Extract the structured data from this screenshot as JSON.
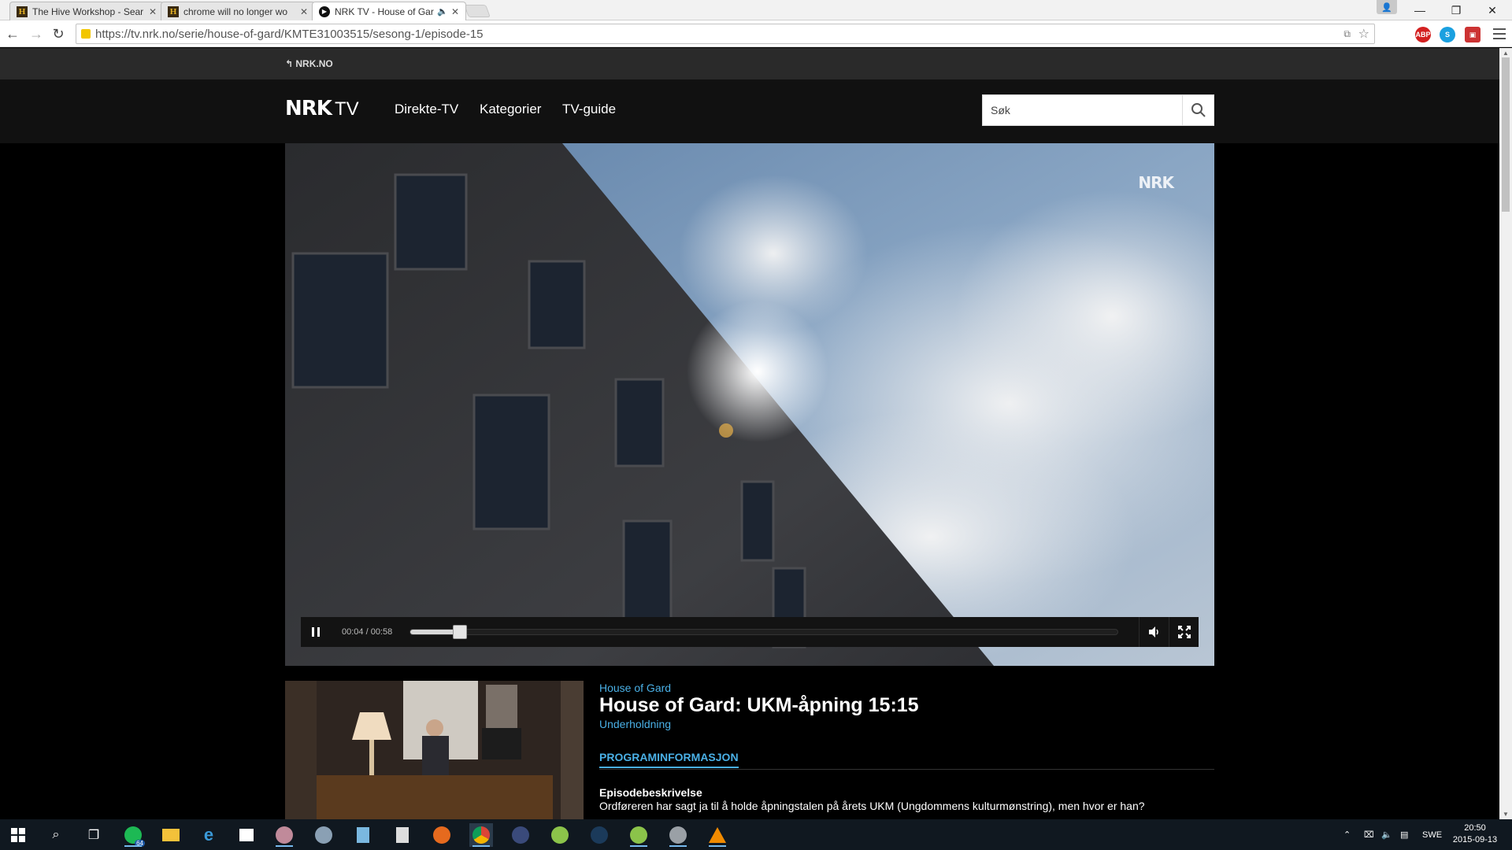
{
  "browser": {
    "tabs": [
      {
        "title": "The Hive Workshop - Sear",
        "favicon": "H",
        "active": false
      },
      {
        "title": "chrome will no longer wo",
        "favicon": "H",
        "active": false
      },
      {
        "title": "NRK TV - House of Gar",
        "favicon": "play",
        "active": true,
        "audio": true
      }
    ],
    "url": "https://tv.nrk.no/serie/house-of-gard/KMTE31003515/sesong-1/episode-15",
    "extensions": [
      "ABP",
      "S"
    ]
  },
  "site": {
    "back_link": "NRK.NO",
    "logo_nrk": "NRK",
    "logo_tv": "TV",
    "nav": [
      "Direkte-TV",
      "Kategorier",
      "TV-guide"
    ],
    "search_placeholder": "Søk"
  },
  "player": {
    "watermark": "NRK",
    "time": "00:04 / 00:58",
    "progress": 0.07,
    "state": "playing"
  },
  "program": {
    "series": "House of Gard",
    "title": "House of Gard: UKM-åpning 15:15",
    "category": "Underholdning",
    "tab": "PROGRAMINFORMASJON",
    "desc_heading": "Episodebeskrivelse",
    "description": "Ordføreren har sagt ja til å holde åpningstalen på årets UKM (Ungdommens kulturmønstring), men hvor er han?"
  },
  "taskbar": {
    "spotify_badge": "64",
    "language": "SWE",
    "time": "20:50",
    "date": "2015-09-13"
  }
}
